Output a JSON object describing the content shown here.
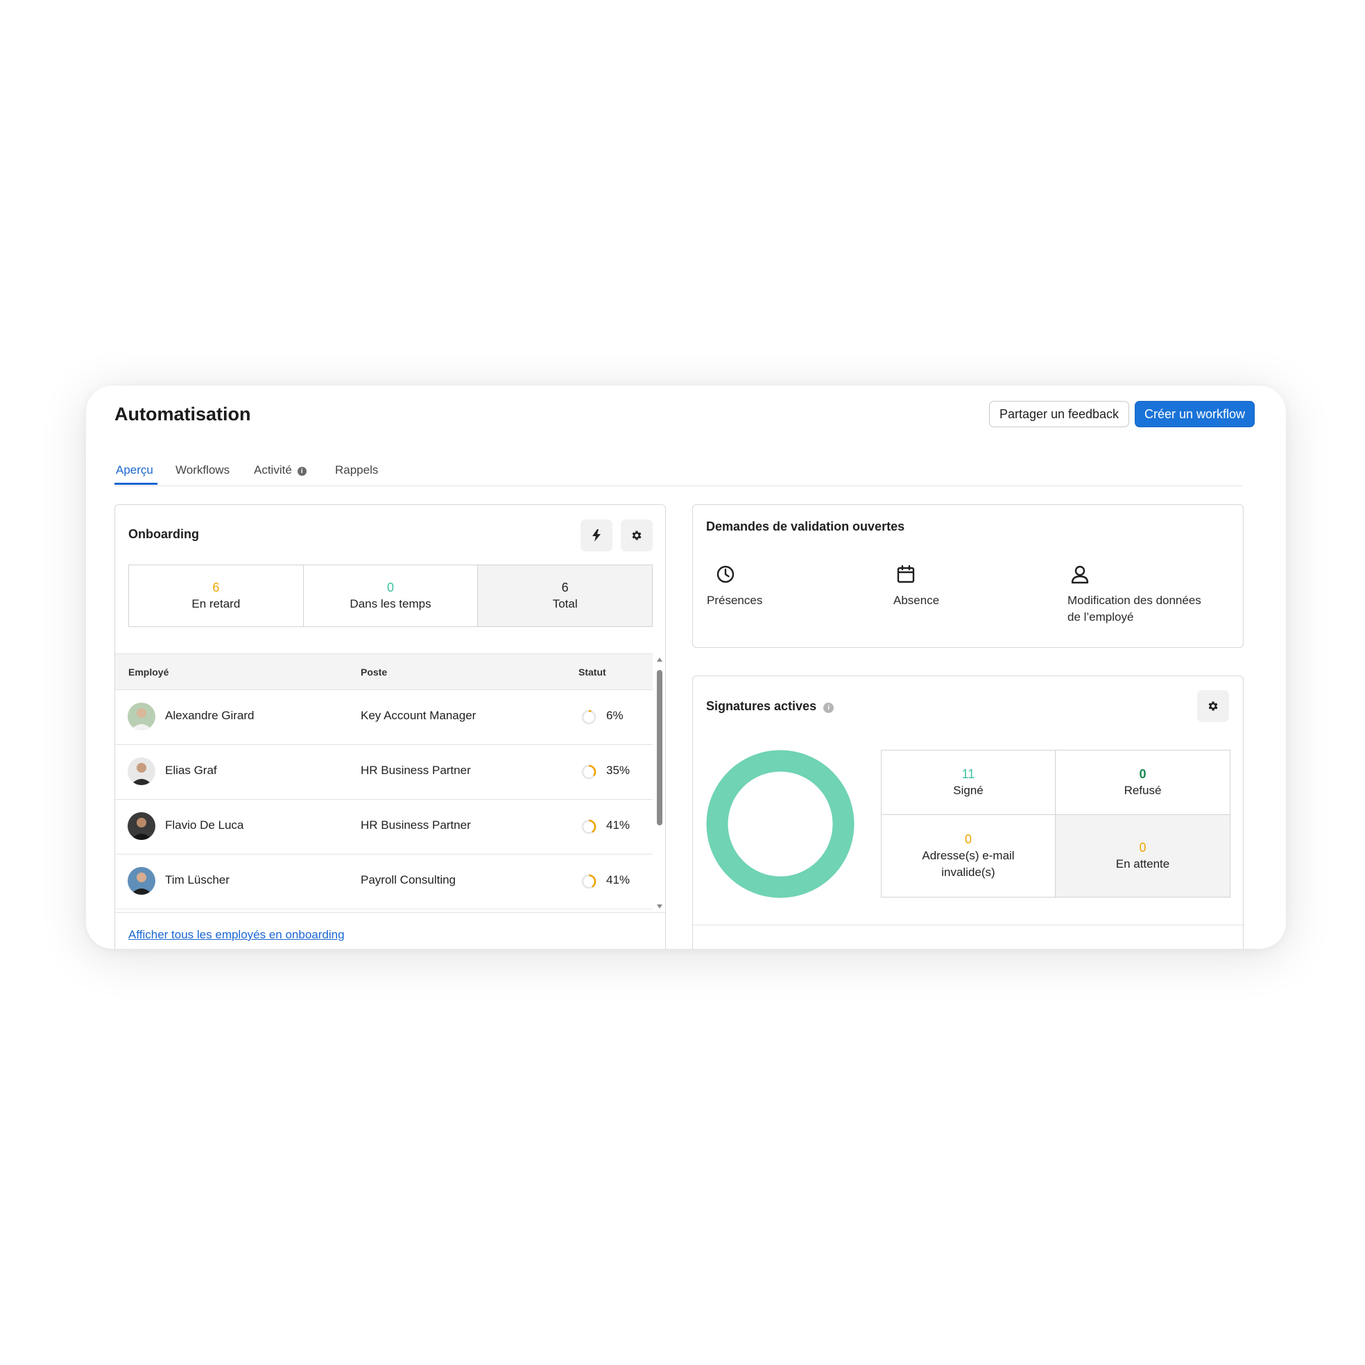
{
  "header": {
    "title": "Automatisation",
    "feedback_label": "Partager un feedback",
    "create_label": "Créer un workflow"
  },
  "tabs": [
    {
      "label": "Aperçu",
      "active": true
    },
    {
      "label": "Workflows",
      "active": false
    },
    {
      "label": "Activité",
      "active": false,
      "has_info_icon": true
    },
    {
      "label": "Rappels",
      "active": false
    }
  ],
  "onboarding": {
    "title": "Onboarding",
    "stats": [
      {
        "value": "6",
        "label": "En retard",
        "color": "#f0a500"
      },
      {
        "value": "0",
        "label": "Dans les temps",
        "color": "#3ec1a0"
      },
      {
        "value": "6",
        "label": "Total",
        "color": "#1f1f1f"
      }
    ],
    "columns": [
      "Employé",
      "Poste",
      "Statut"
    ],
    "rows": [
      {
        "name": "Alexandre Girard",
        "position": "Key Account Manager",
        "status": "6%",
        "progress": 0.06
      },
      {
        "name": "Elias Graf",
        "position": "HR Business Partner",
        "status": "35%",
        "progress": 0.35
      },
      {
        "name": "Flavio De Luca",
        "position": "HR Business Partner",
        "status": "41%",
        "progress": 0.41
      },
      {
        "name": "Tim Lüscher",
        "position": "Payroll Consulting",
        "status": "41%",
        "progress": 0.41
      }
    ],
    "link": "Afficher tous les employés en onboarding"
  },
  "validation": {
    "title": "Demandes de validation ouvertes",
    "items": [
      {
        "icon": "clock-icon",
        "label": "Présences"
      },
      {
        "icon": "calendar-icon",
        "label": "Absence"
      },
      {
        "icon": "person-icon",
        "label_line1": "Modification des données",
        "label_line2": "de l’employé"
      }
    ]
  },
  "signatures": {
    "title": "Signatures actives",
    "cells": [
      {
        "value": "11",
        "label": "Signé",
        "color": "#3ec1a0"
      },
      {
        "value": "0",
        "label": "Refusé",
        "color": "#16894f"
      },
      {
        "value": "0",
        "label_line1": "Adresse(s) e-mail",
        "label_line2": "invalide(s)",
        "color": "#f0a500"
      },
      {
        "value": "0",
        "label": "En attente",
        "color": "#f0a500"
      }
    ],
    "donut_color": "#6fd3b4"
  },
  "colors": {
    "accent": "#1a73d8",
    "warning": "#f0a500",
    "success": "#3ec1a0"
  }
}
